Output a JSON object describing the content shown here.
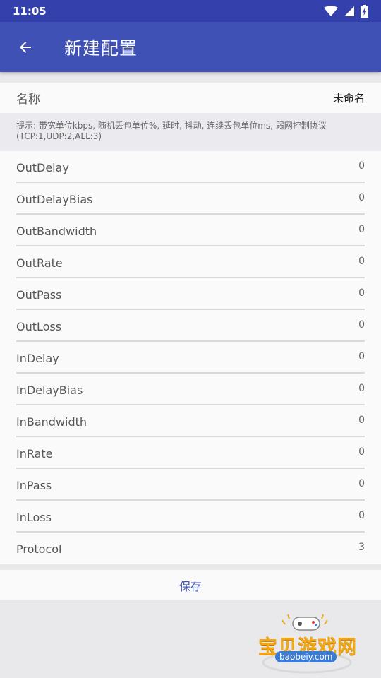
{
  "status_bar": {
    "time": "11:05"
  },
  "app_bar": {
    "title": "新建配置"
  },
  "name_field": {
    "label": "名称",
    "value": "未命名"
  },
  "hint": "提示: 带宽单位kbps, 随机丢包单位%, 延时, 抖动, 连续丢包单位ms, 弱网控制协议(TCP:1,UDP:2,ALL:3)",
  "params": [
    {
      "label": "OutDelay",
      "value": "0"
    },
    {
      "label": "OutDelayBias",
      "value": "0"
    },
    {
      "label": "OutBandwidth",
      "value": "0"
    },
    {
      "label": "OutRate",
      "value": "0"
    },
    {
      "label": "OutPass",
      "value": "0"
    },
    {
      "label": "OutLoss",
      "value": "0"
    },
    {
      "label": "InDelay",
      "value": "0"
    },
    {
      "label": "InDelayBias",
      "value": "0"
    },
    {
      "label": "InBandwidth",
      "value": "0"
    },
    {
      "label": "InRate",
      "value": "0"
    },
    {
      "label": "InPass",
      "value": "0"
    },
    {
      "label": "InLoss",
      "value": "0"
    },
    {
      "label": "Protocol",
      "value": "3"
    }
  ],
  "save_label": "保存",
  "watermark": {
    "text": "宝贝游戏网",
    "url": "baobeiy.com"
  },
  "colors": {
    "primary": "#3f51b5",
    "status_bar": "#3441ad",
    "background": "#e9e9ec"
  }
}
